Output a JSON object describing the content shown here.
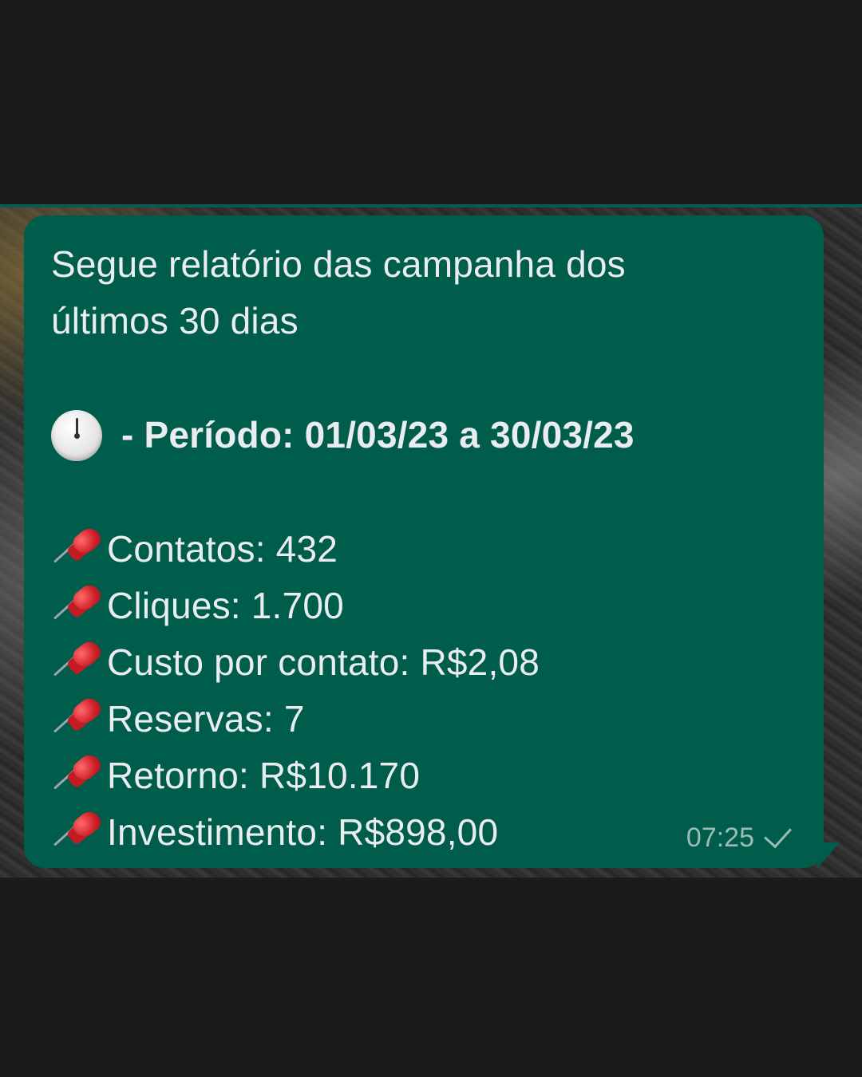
{
  "message": {
    "intro": "Segue relatório das campanha dos últimos 30 dias",
    "intro_line1": "Segue relatório das campanha dos",
    "intro_line2": "últimos 30 dias",
    "period": "- Período: 01/03/23 a 30/03/23",
    "period_icon": "clock-icon",
    "metrics_icon": "pushpin-icon",
    "metrics": [
      "Contatos: 432",
      "Cliques: 1.700",
      "Custo por contato: R$2,08",
      "Reservas: 7",
      "Retorno: R$10.170",
      "Investimento: R$898,00"
    ],
    "time": "07:25",
    "status": "sent-checkmark"
  },
  "colors": {
    "bubble": "#005c4b",
    "text": "#e9edef",
    "meta": "#9bbdb5",
    "background": "#1b1b1b"
  }
}
